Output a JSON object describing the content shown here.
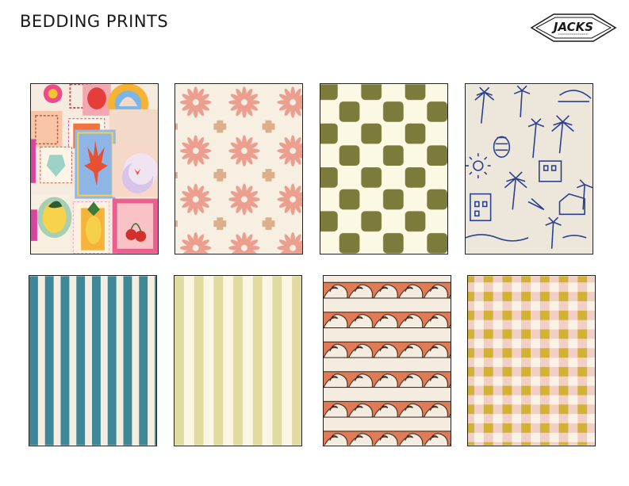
{
  "page": {
    "title": "BEDDING PRINTS"
  },
  "logo": {
    "brand": "JACKS"
  },
  "prints": [
    {
      "id": "novelty-stamps",
      "description": ""
    },
    {
      "id": "blush-floral",
      "description": ""
    },
    {
      "id": "olive-check",
      "description": ""
    },
    {
      "id": "navy-palm-toile",
      "description": ""
    },
    {
      "id": "teal-stripe",
      "description": ""
    },
    {
      "id": "green-stripe",
      "description": ""
    },
    {
      "id": "orange-wave",
      "description": ""
    },
    {
      "id": "pink-mustard-check",
      "description": ""
    }
  ],
  "colors": {
    "teal": "#3f8797",
    "cream": "#f6f1e4",
    "olive": "#7b7b3c",
    "navy": "#2b3f8f",
    "blush": "#e9a79a",
    "mustard": "#d1b235",
    "orange": "#e17b55"
  }
}
